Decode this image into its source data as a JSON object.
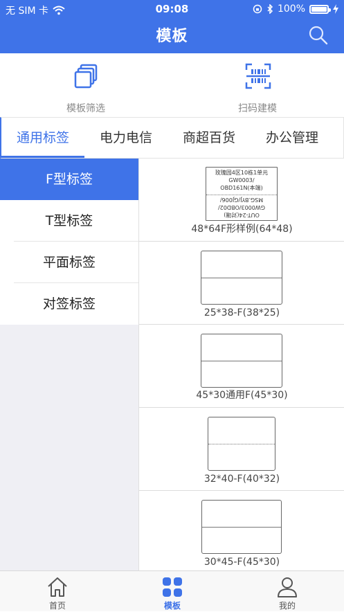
{
  "status": {
    "carrier": "无 SIM 卡",
    "time": "09:08",
    "battery": "100%"
  },
  "header": {
    "title": "模板"
  },
  "quick_actions": [
    {
      "label": "模板筛选"
    },
    {
      "label": "扫码建模"
    }
  ],
  "tabs": [
    {
      "label": "通用标签",
      "active": true
    },
    {
      "label": "电力电信"
    },
    {
      "label": "商超百货"
    },
    {
      "label": "办公管理"
    }
  ],
  "categories": [
    {
      "label": "F型标签",
      "active": true
    },
    {
      "label": "T型标签"
    },
    {
      "label": "平面标签"
    },
    {
      "label": "对签标签"
    }
  ],
  "templates": [
    {
      "name": "48*64F形样例(64*48)",
      "sample_lines_top": [
        "玫瑰园4区10栋1单元",
        "GW0003/",
        "OBD161N(本端)"
      ],
      "sample_lines_bottom": [
        "OUT-24(对端)",
        "GW0003/OBD02/",
        "MSG.BYJ/GJ006/"
      ]
    },
    {
      "name": "25*38-F(38*25)"
    },
    {
      "name": "45*30通用F(45*30)"
    },
    {
      "name": "32*40-F(40*32)"
    },
    {
      "name": "30*45-F(45*30)"
    }
  ],
  "bottom_nav": [
    {
      "label": "首页"
    },
    {
      "label": "模板",
      "active": true
    },
    {
      "label": "我的"
    }
  ],
  "colors": {
    "accent": "#3f73e8"
  }
}
